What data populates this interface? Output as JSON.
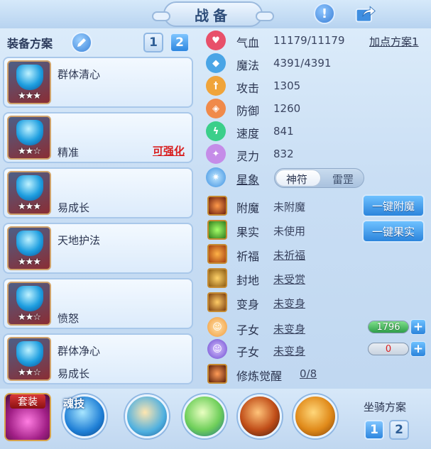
{
  "header": {
    "title": "战备"
  },
  "left": {
    "scheme_label": "装备方案",
    "scheme_buttons": [
      "1",
      "2"
    ],
    "items": [
      {
        "name": "群体清心",
        "sub": "",
        "stars": "★★★",
        "strength": ""
      },
      {
        "name": "",
        "sub": "精准",
        "stars": "★★☆",
        "strength": "可强化"
      },
      {
        "name": "",
        "sub": "易成长",
        "stars": "★★★",
        "strength": ""
      },
      {
        "name": "天地护法",
        "sub": "",
        "stars": "★★★",
        "strength": ""
      },
      {
        "name": "",
        "sub": "愤怒",
        "stars": "★★☆",
        "strength": ""
      },
      {
        "name": "群体净心",
        "sub": "易成长",
        "stars": "★★☆",
        "strength": ""
      }
    ]
  },
  "stats": {
    "plan_link": "加点方案1",
    "rows": [
      {
        "name": "气血",
        "value": "11179/11179",
        "color": "#e8506a"
      },
      {
        "name": "魔法",
        "value": "4391/4391",
        "color": "#4aa5e6"
      },
      {
        "name": "攻击",
        "value": "1305",
        "color": "#f0a43a"
      },
      {
        "name": "防御",
        "value": "1260",
        "color": "#f08a4a"
      },
      {
        "name": "速度",
        "value": "841",
        "color": "#3bcf8a"
      },
      {
        "name": "灵力",
        "value": "832",
        "color": "#c58ce8"
      }
    ],
    "star_label": "星象",
    "star_options": [
      "神符",
      "雷罡"
    ]
  },
  "enhancements": {
    "rows": [
      {
        "name": "附魔",
        "value": "未附魔",
        "link": false
      },
      {
        "name": "果实",
        "value": "未使用",
        "link": false
      },
      {
        "name": "祈福",
        "value": "未祈福",
        "link": true
      },
      {
        "name": "封地",
        "value": "未受赏",
        "link": true
      },
      {
        "name": "变身",
        "value": "未变身",
        "link": true
      }
    ],
    "btn_enchant": "一键附魔",
    "btn_fruit": "一键果实",
    "children": [
      {
        "name": "子女",
        "value": "未变身",
        "bar_value": "1796"
      },
      {
        "name": "子女",
        "value": "未变身",
        "bar_value": "0"
      }
    ],
    "cultivate_name": "修炼觉醒",
    "cultivate_value": "0/8"
  },
  "bottom": {
    "suit_tag": "套装",
    "soul_tag": "魂技",
    "mount_label": "坐骑方案",
    "mount_buttons": [
      "1",
      "2"
    ]
  }
}
